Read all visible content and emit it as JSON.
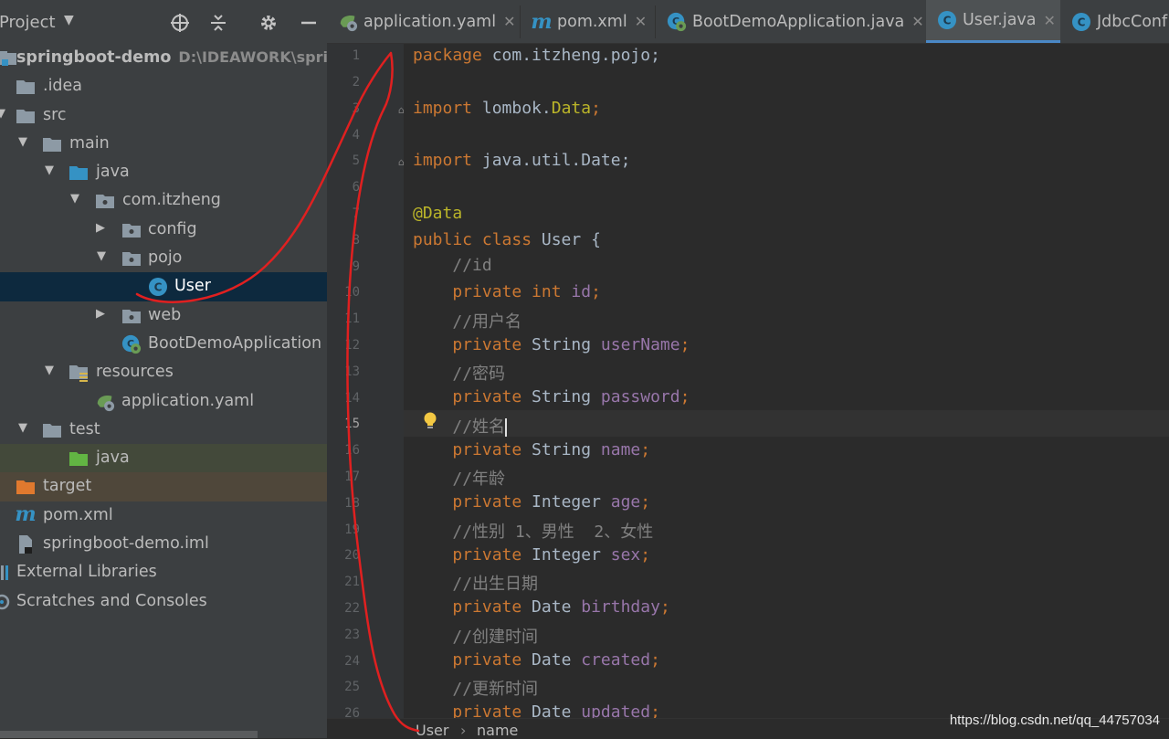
{
  "project_panel": {
    "title": "Project",
    "tree": [
      {
        "label": "springboot-demo",
        "path": "D:\\IDEAWORK\\springb"
      },
      {
        "label": ".idea"
      },
      {
        "label": "src"
      },
      {
        "label": "main"
      },
      {
        "label": "java"
      },
      {
        "label": "com.itzheng"
      },
      {
        "label": "config"
      },
      {
        "label": "pojo"
      },
      {
        "label": "User"
      },
      {
        "label": "web"
      },
      {
        "label": "BootDemoApplication"
      },
      {
        "label": "resources"
      },
      {
        "label": "application.yaml"
      },
      {
        "label": "test"
      },
      {
        "label": "java"
      },
      {
        "label": "target"
      },
      {
        "label": "pom.xml"
      },
      {
        "label": "springboot-demo.iml"
      },
      {
        "label": "External Libraries"
      },
      {
        "label": "Scratches and Consoles"
      }
    ]
  },
  "tabs": [
    {
      "label": "application.yaml",
      "icon": "spring-yaml-icon"
    },
    {
      "label": "pom.xml",
      "icon": "maven-icon"
    },
    {
      "label": "BootDemoApplication.java",
      "icon": "spring-class-icon"
    },
    {
      "label": "User.java",
      "icon": "class-icon",
      "active": true
    },
    {
      "label": "JdbcConf",
      "icon": "class-icon"
    }
  ],
  "editor": {
    "current_line": 15,
    "line_numbers": [
      "1",
      "2",
      "3",
      "4",
      "5",
      "6",
      "7",
      "8",
      "9",
      "10",
      "11",
      "12",
      "13",
      "14",
      "15",
      "16",
      "17",
      "18",
      "19",
      "20",
      "21",
      "22",
      "23",
      "24",
      "25",
      "26"
    ],
    "code": {
      "l1_kw": "package",
      "l1_rest": " com.itzheng.pojo;",
      "l3_kw": "import",
      "l3_rest": " lombok.",
      "l3_an": "Data",
      "l3_end": ";",
      "l5_kw": "import",
      "l5_rest": " java.util.Date;",
      "l7_an": "@Data",
      "l8_kw": "public class",
      "l8_rest": " User {",
      "l9_cm": "//id",
      "l10_kw": "private int",
      "l10_fd": " id",
      "l10_end": ";",
      "l11_cm": "//用户名",
      "l12_kw": "private",
      "l12_type": " String",
      "l12_fd": " userName",
      "l12_end": ";",
      "l13_cm": "//密码",
      "l14_kw": "private",
      "l14_type": " String",
      "l14_fd": " password",
      "l14_end": ";",
      "l15_cm": "//姓名",
      "l16_kw": "private",
      "l16_type": " String",
      "l16_fd": " name",
      "l16_end": ";",
      "l17_cm": "//年龄",
      "l18_kw": "private",
      "l18_type": " Integer",
      "l18_fd": " age",
      "l18_end": ";",
      "l19_cm": "//性别 1、男性  2、女性",
      "l20_kw": "private",
      "l20_type": " Integer",
      "l20_fd": " sex",
      "l20_end": ";",
      "l21_cm": "//出生日期",
      "l22_kw": "private",
      "l22_type": " Date",
      "l22_fd": " birthday",
      "l22_end": ";",
      "l23_cm": "//创建时间",
      "l24_kw": "private",
      "l24_type": " Date",
      "l24_fd": " created",
      "l24_end": ";",
      "l25_cm": "//更新时间",
      "l26_kw": "private",
      "l26_type": " Date",
      "l26_fd": " updated",
      "l26_end": ";"
    }
  },
  "breadcrumb": {
    "class": "User",
    "separator": "›",
    "member": "name"
  },
  "watermark": "https://blog.csdn.net/qq_44757034",
  "colors": {
    "keyword": "#cc7832",
    "annotation": "#bbb529",
    "comment": "#808080",
    "field": "#9876aa",
    "text": "#a9b7c6",
    "selection": "#0d293e",
    "annotation_stroke": "#e02020"
  }
}
